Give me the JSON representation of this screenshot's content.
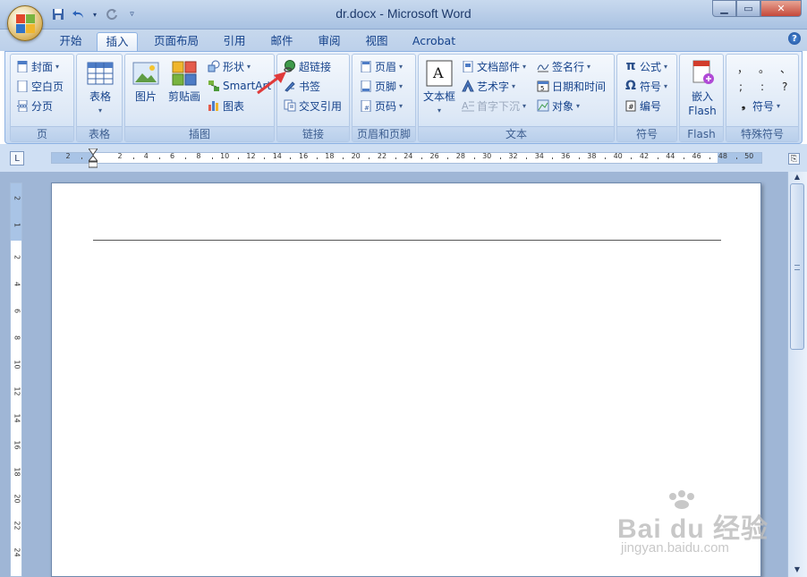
{
  "window": {
    "title": "dr.docx - Microsoft Word",
    "minimize_icon": "minimize-icon",
    "maximize_icon": "maximize-icon",
    "close_icon": "close-icon"
  },
  "tabs": [
    "开始",
    "插入",
    "页面布局",
    "引用",
    "邮件",
    "审阅",
    "视图",
    "Acrobat"
  ],
  "active_tab": "插入",
  "groups": {
    "pages": {
      "label": "页",
      "cover": "封面",
      "blank": "空白页",
      "break": "分页"
    },
    "tables": {
      "label": "表格",
      "table": "表格"
    },
    "illustrations": {
      "label": "插图",
      "picture": "图片",
      "clipart": "剪贴画",
      "shapes": "形状",
      "smartart": "SmartArt",
      "chart": "图表"
    },
    "links": {
      "label": "链接",
      "hyperlink": "超链接",
      "bookmark": "书签",
      "crossref": "交叉引用"
    },
    "header_footer": {
      "label": "页眉和页脚",
      "header": "页眉",
      "footer": "页脚",
      "pagenum": "页码"
    },
    "text": {
      "label": "文本",
      "textbox": "文本框",
      "quickparts": "文档部件",
      "wordart": "艺术字",
      "dropcap": "首字下沉",
      "signature": "签名行",
      "datetime": "日期和时间",
      "object": "对象"
    },
    "symbols": {
      "label": "符号",
      "equation": "公式",
      "symbol": "符号",
      "number": "编号"
    },
    "flash": {
      "label": "Flash",
      "embed_line1": "嵌入",
      "embed_line2": "Flash"
    },
    "special": {
      "label": "特殊符号",
      "symbol": "符号",
      "chars": [
        "，",
        "。",
        "、",
        ";",
        ":",
        "?"
      ]
    }
  },
  "ruler": {
    "h_ticks": [
      "2",
      "2",
      "4",
      "6",
      "8",
      "10",
      "12",
      "14",
      "16",
      "18",
      "20",
      "22",
      "24",
      "26",
      "28",
      "30",
      "32",
      "34",
      "36",
      "38",
      "40",
      "42",
      "44",
      "46",
      "48",
      "50"
    ],
    "v_ticks": [
      "2",
      "1",
      "2",
      "4",
      "6",
      "8",
      "10",
      "12",
      "14",
      "16",
      "18",
      "20",
      "22",
      "24"
    ]
  },
  "watermark": {
    "brand": "Bai du 经验",
    "url": "jingyan.baidu.com"
  },
  "colors": {
    "accent": "#15428b",
    "ribbon": "#dde8f6",
    "arrow": "#e03a3a"
  }
}
